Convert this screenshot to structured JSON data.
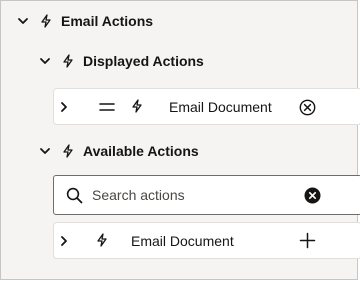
{
  "section": {
    "title": "Email Actions",
    "displayed": {
      "title": "Displayed Actions",
      "items": [
        {
          "label": "Email Document"
        }
      ]
    },
    "available": {
      "title": "Available Actions",
      "search": {
        "placeholder": "Search actions",
        "value": ""
      },
      "items": [
        {
          "label": "Email Document"
        }
      ]
    }
  },
  "icons": {
    "collapse": "chevron-down-icon",
    "expand": "chevron-right-icon",
    "action": "lightning-bolt-icon",
    "drag": "drag-handle-icon",
    "remove": "remove-circle-icon",
    "search": "search-icon",
    "clear": "clear-icon",
    "add": "plus-icon"
  },
  "colors": {
    "background": "#f5f4f2",
    "card": "#ffffff",
    "text": "#161513",
    "border": "#c9c5c0"
  }
}
